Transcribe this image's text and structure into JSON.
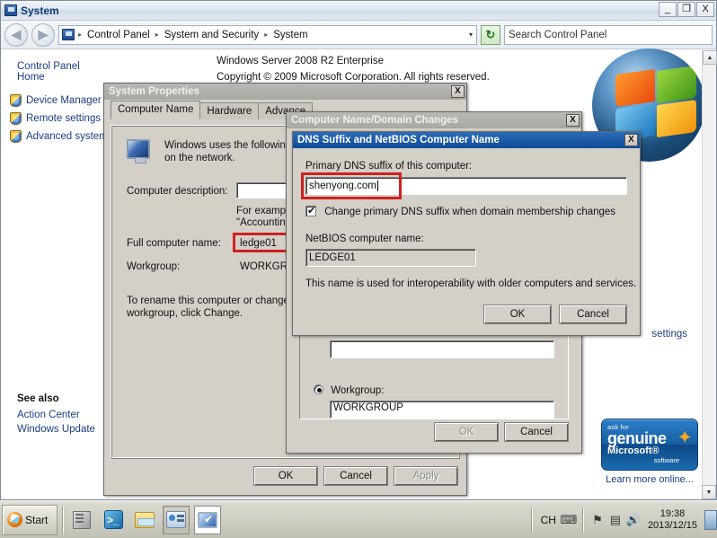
{
  "explorer": {
    "title": "System",
    "window_controls": {
      "minimize": "_",
      "restore": "❐",
      "close": "X"
    },
    "nav": {
      "back": "◀",
      "forward": "▶"
    },
    "breadcrumb": {
      "items": [
        "Control Panel",
        "System and Security",
        "System"
      ],
      "separator": "▸",
      "dropdown": "▾"
    },
    "refresh_label": "↻",
    "search": {
      "placeholder": "Search Control Panel",
      "icon": "🔍"
    },
    "sidebar": {
      "home": "Control Panel Home",
      "items": [
        {
          "label": "Device Manager"
        },
        {
          "label": "Remote settings"
        },
        {
          "label": "Advanced system"
        }
      ],
      "see_also_heading": "See also",
      "see_also_items": [
        "Action Center",
        "Windows Update"
      ]
    },
    "main": {
      "os_name": "Windows Server 2008 R2 Enterprise",
      "copyright": "Copyright © 2009 Microsoft Corporation.   All rights reserved.",
      "partial_settings_text": "settings",
      "genuine": {
        "ask_for": "ask for",
        "genuine": "genuine",
        "microsoft": "Microsoft®",
        "software": "software",
        "star": "✦",
        "learn_more": "Learn more online..."
      }
    },
    "scrollbar": {
      "up": "▲",
      "down": "▼"
    }
  },
  "system_properties": {
    "title": "System Properties",
    "close": "X",
    "tabs": [
      {
        "label": "Computer Name",
        "selected": true
      },
      {
        "label": "Hardware",
        "selected": false
      },
      {
        "label": "Advance",
        "selected": false
      }
    ],
    "intro_line1": "Windows uses the following",
    "intro_line2": "on the network.",
    "description_label": "Computer description:",
    "description_value": "",
    "example_line1": "For example",
    "example_line2": "\"Accounting",
    "full_name_label": "Full computer name:",
    "full_name_value": "ledge01",
    "workgroup_label": "Workgroup:",
    "workgroup_value": "WORKGRO",
    "hint_line1": "To rename this computer or change its",
    "hint_line2": "workgroup, click Change.",
    "buttons": {
      "ok": "OK",
      "cancel": "Cancel",
      "apply": "Apply"
    }
  },
  "computer_name_domain_changes": {
    "title": "Computer Name/Domain Changes",
    "close": "X",
    "member_field_value": "",
    "workgroup_radio_label": "Workgroup:",
    "workgroup_value": "WORKGROUP",
    "buttons": {
      "ok": "OK",
      "cancel": "Cancel"
    }
  },
  "dns_suffix_dialog": {
    "title": "DNS Suffix and NetBIOS Computer Name",
    "close": "X",
    "primary_dns_label": "Primary DNS suffix of this computer:",
    "primary_dns_value": "shenyong.com",
    "checkbox_label": "Change primary DNS suffix when domain membership changes",
    "checkbox_checked": true,
    "netbios_label": "NetBIOS computer name:",
    "netbios_value": "LEDGE01",
    "note": "This name is used for interoperability with older computers and services.",
    "buttons": {
      "ok": "OK",
      "cancel": "Cancel"
    }
  },
  "taskbar": {
    "start_label": "Start",
    "quick_launch": [
      {
        "name": "server-manager"
      },
      {
        "name": "powershell"
      },
      {
        "name": "windows-explorer"
      }
    ],
    "tray": {
      "language": "CH",
      "keyboard_icon": "⌨",
      "flag_icon": "⚑",
      "network_icon": "▤",
      "volume_icon": "🔊",
      "time": "19:38",
      "date": "2013/12/15"
    }
  }
}
